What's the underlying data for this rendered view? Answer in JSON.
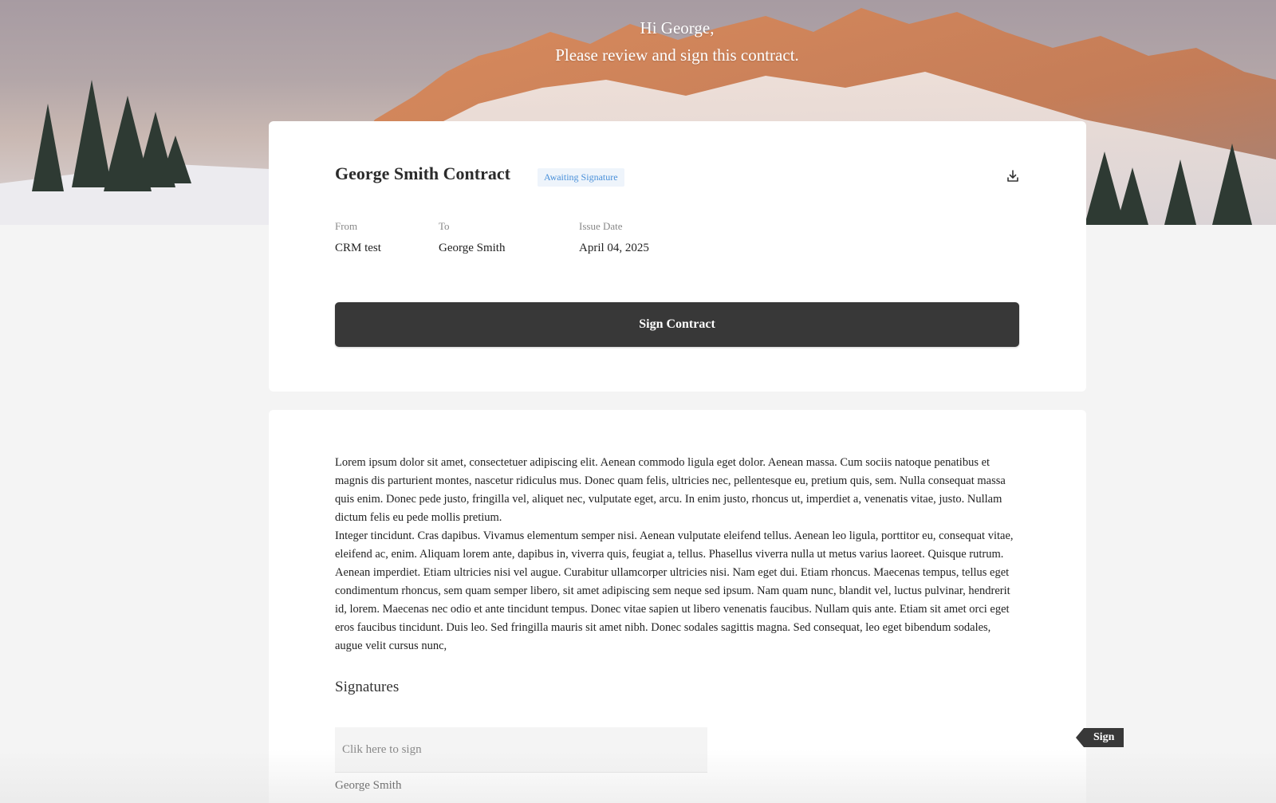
{
  "greeting": {
    "line1": "Hi George,",
    "line2": "Please review and sign this contract."
  },
  "contract": {
    "title": "George Smith Contract",
    "status_badge": "Awaiting Signature",
    "download_icon": "download-icon",
    "from_label": "From",
    "from_value": "CRM test",
    "to_label": "To",
    "to_value": "George Smith",
    "issue_date_label": "Issue Date",
    "issue_date_value": "April 04, 2025",
    "sign_button_label": "Sign Contract"
  },
  "body": {
    "paragraph1": "Lorem ipsum dolor sit amet, consectetuer adipiscing elit. Aenean commodo ligula eget dolor. Aenean massa. Cum sociis natoque penatibus et magnis dis parturient montes, nascetur ridiculus mus. Donec quam felis, ultricies nec, pellentesque eu, pretium quis, sem. Nulla consequat massa quis enim. Donec pede justo, fringilla vel, aliquet nec, vulputate eget, arcu. In enim justo, rhoncus ut, imperdiet a, venenatis vitae, justo. Nullam dictum felis eu pede mollis pretium.",
    "paragraph2": "Integer tincidunt. Cras dapibus. Vivamus elementum semper nisi. Aenean vulputate eleifend tellus. Aenean leo ligula, porttitor eu, consequat vitae, eleifend ac, enim. Aliquam lorem ante, dapibus in, viverra quis, feugiat a, tellus. Phasellus viverra nulla ut metus varius laoreet. Quisque rutrum. Aenean imperdiet. Etiam ultricies nisi vel augue. Curabitur ullamcorper ultricies nisi. Nam eget dui. Etiam rhoncus. Maecenas tempus, tellus eget condimentum rhoncus, sem quam semper libero, sit amet adipiscing sem neque sed ipsum. Nam quam nunc, blandit vel, luctus pulvinar, hendrerit id, lorem. Maecenas nec odio et ante tincidunt tempus. Donec vitae sapien ut libero venenatis faucibus. Nullam quis ante. Etiam sit amet orci eget eros faucibus tincidunt. Duis leo. Sed fringilla mauris sit amet nibh. Donec sodales sagittis magna. Sed consequat, leo eget bibendum sodales, augue velit cursus nunc,",
    "signatures_heading": "Signatures",
    "signature_placeholder": "Clik here to sign",
    "signer_name": "George Smith",
    "sign_tag_label": "Sign"
  },
  "colors": {
    "button_dark": "#383838",
    "badge_text": "#4a90d9",
    "badge_bg": "#eef4fb",
    "page_bg": "#f4f4f4"
  }
}
